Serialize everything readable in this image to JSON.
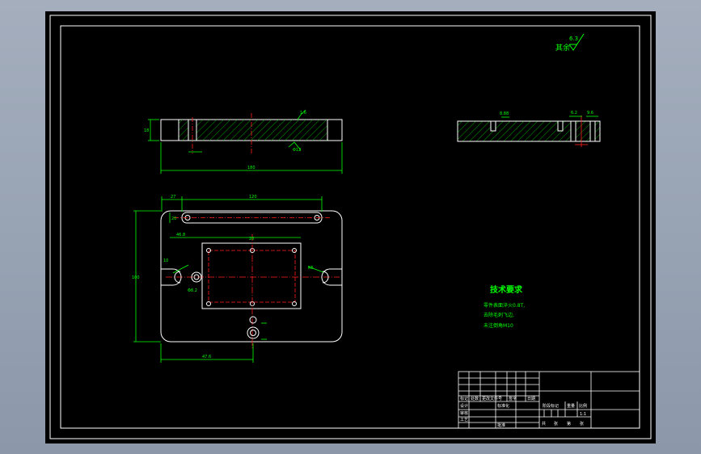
{
  "drawing": {
    "roughness_note": "其余",
    "roughness_value": "6.3",
    "side_view": {
      "dim_height": "18",
      "dim_total": "180",
      "dim_surface": "1.6",
      "dim_hole": "Φ12"
    },
    "end_view": {
      "dim_left": "8.88",
      "dim_right_a": "6.2",
      "dim_right_b": "9.6"
    },
    "plan_view": {
      "dim_top_left": "27",
      "dim_top_span": "120",
      "dim_left_total": "100",
      "dim_slot": "20",
      "dim_inner_left": "46.8",
      "dim_left_slot": "10",
      "dim_hole": "Φ8.2",
      "dim_bottom_a": "20",
      "dim_bottom_b": "47.6",
      "dim_r": "R5"
    },
    "notes": {
      "heading": "技术要求",
      "line1": "零件表面淬火0.8T,",
      "line2": "去除毛刺飞边,",
      "line3": "未注倒角M10"
    },
    "title_block": {
      "c1": "标记",
      "c2": "处数",
      "c3": "更改文件号",
      "c4": "签字",
      "c5": "日期",
      "design": "设计",
      "standard": "标准化",
      "check": "审核",
      "process": "工艺",
      "approve": "批准",
      "stage": "阶段标记",
      "weight": "重量",
      "scale": "比例",
      "scale_value": "1:1",
      "sheet_a": "共",
      "sheet_b": "张",
      "sheet_c": "第",
      "sheet_d": "张"
    }
  }
}
